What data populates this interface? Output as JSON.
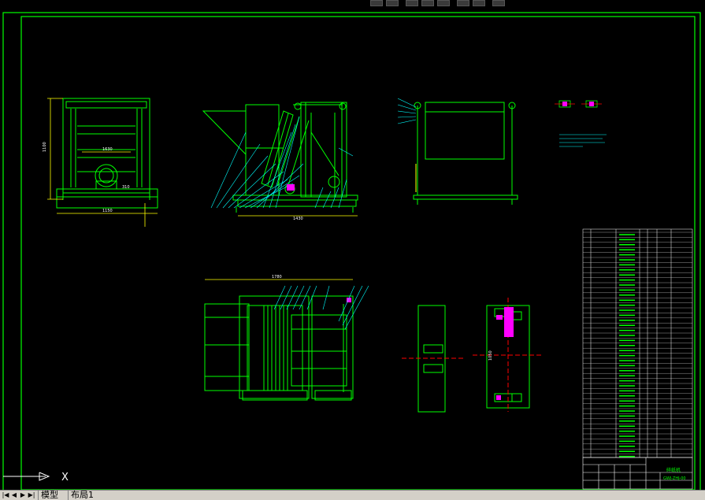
{
  "tabs": {
    "model": "模型",
    "layout": "布局1"
  },
  "nav": {
    "first": "|◀",
    "prev": "◀",
    "next": "▶",
    "last": "▶|"
  },
  "colors": {
    "background": "#000000",
    "border": "#00ff00",
    "text": "#ffffff",
    "dimension": "#00ffff",
    "hatch": "#00cc00",
    "accent": "#ff00ff",
    "yellow": "#ffff00"
  },
  "drawing": {
    "dim_front_height": "1100",
    "dim_front_width": "1630",
    "dim_front_bottom": "1150",
    "dim_front_small": "310",
    "dim_side_bottom": "1430",
    "dim_plan_top": "1780",
    "dim_plan_right": "1050",
    "dim_detail_small": "1050",
    "title_block_name": "碎纸机",
    "title_block_dwg": "GWJ-ZHJ-00"
  },
  "ucs": {
    "x_label": "X"
  }
}
